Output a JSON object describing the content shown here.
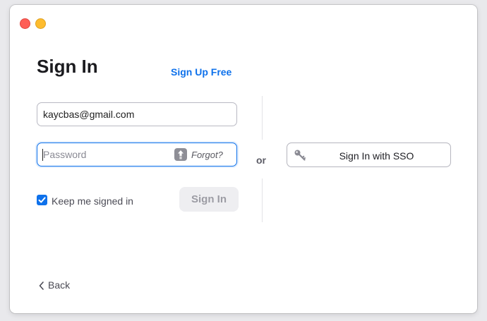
{
  "window": {
    "title": "Sign In",
    "signup_link": "Sign Up Free"
  },
  "form": {
    "email_value": "kaycbas@gmail.com",
    "password_placeholder": "Password",
    "forgot_label": "Forgot?",
    "keep_signed_in_label": "Keep me signed in",
    "keep_signed_in_checked": true,
    "signin_button": "Sign In"
  },
  "separator": {
    "or_label": "or"
  },
  "sso": {
    "button_label": "Sign In with SSO",
    "icon": "key-icon"
  },
  "footer": {
    "back_label": "Back",
    "back_icon": "chevron-left-icon"
  },
  "colors": {
    "accent": "#0e71eb",
    "close": "#fe5f57",
    "minimize": "#febc2e"
  }
}
